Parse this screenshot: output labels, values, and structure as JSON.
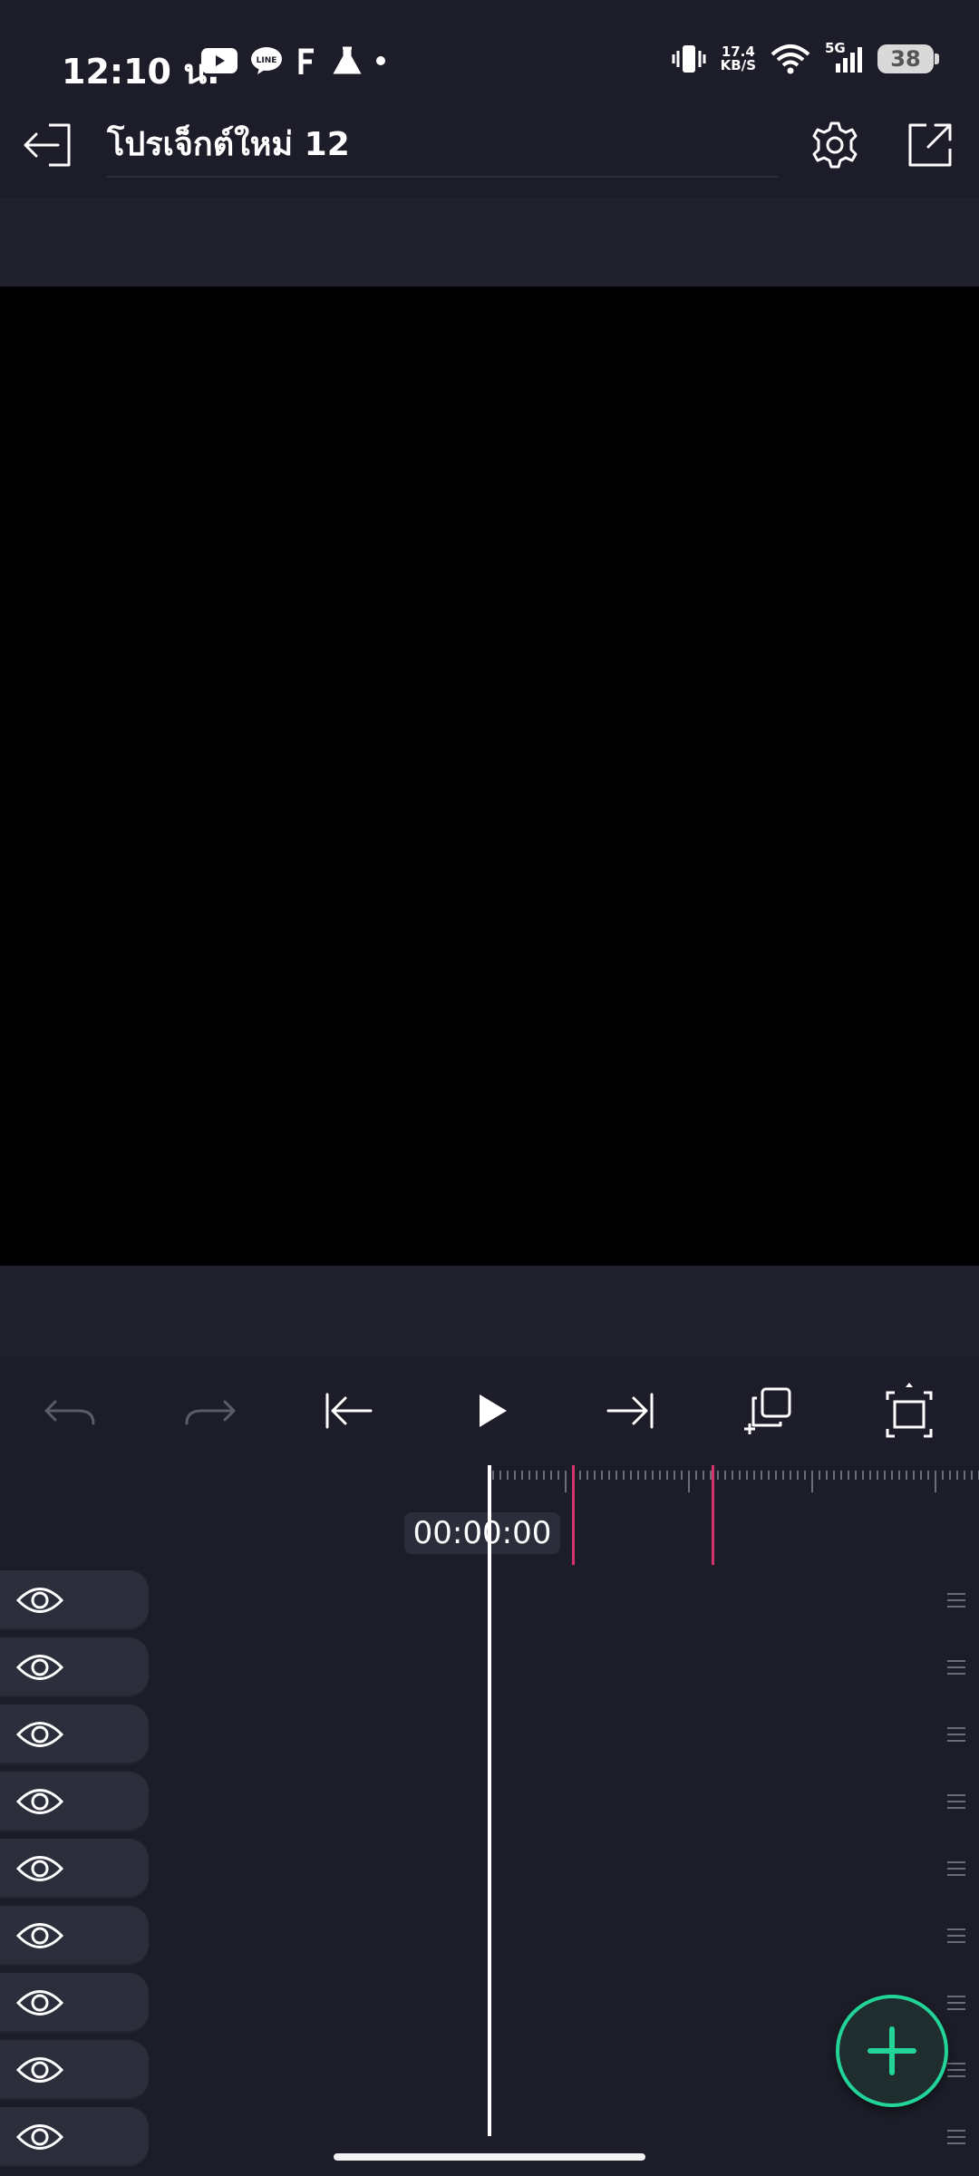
{
  "status_bar": {
    "time": "12:10 น.",
    "network_speed_value": "17.4",
    "network_speed_unit": "KB/S",
    "network_type": "5G",
    "battery": "38",
    "icons": [
      "youtube-icon",
      "line-icon",
      "f-icon",
      "flask-icon",
      "dot-icon",
      "vibrate-icon",
      "wifi-icon",
      "signal-icon",
      "battery-icon"
    ]
  },
  "header": {
    "title": "โปรเจ็กต์ใหม่ 12",
    "icons": [
      "exit-icon",
      "settings-icon",
      "export-icon"
    ]
  },
  "toolbar": {
    "icons": [
      "undo-icon",
      "redo-icon",
      "skip-to-start-icon",
      "play-icon",
      "skip-to-end-icon",
      "duplicate-icon",
      "fullscreen-icon"
    ]
  },
  "timeline": {
    "timecode": "00:00:00",
    "track_count": 9
  },
  "fab": {
    "icon": "plus-icon"
  },
  "colors": {
    "background": "#1c1d28",
    "preview": "#000000",
    "accent": "#21d497",
    "marker": "#d6336c",
    "track": "#2c2e3b"
  }
}
